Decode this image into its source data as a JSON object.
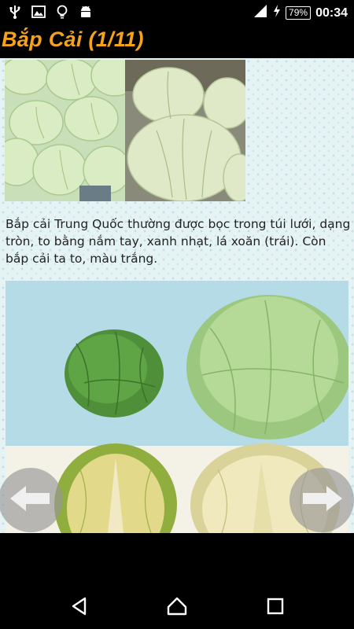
{
  "status_bar": {
    "left_icons": [
      "usb-icon",
      "image-icon",
      "lightbulb-icon",
      "android-icon"
    ],
    "battery_percent": "79%",
    "time": "00:34"
  },
  "page": {
    "title": "Bắp Cải (1/11)"
  },
  "content": {
    "caption": "Bắp cải Trung Quốc thường được bọc trong túi lưới, dạng tròn, to bằng nắm tay, xanh nhạt, lá xoăn (trái). Còn bắp cải ta to, màu trắng.",
    "colors": {
      "title": "#f7a21b",
      "background": "#e6f3f5"
    }
  },
  "navigation": {
    "prev_icon": "arrow-left-icon",
    "next_icon": "arrow-right-icon"
  },
  "system_nav": {
    "icons": [
      "back-icon",
      "home-icon",
      "recents-icon"
    ]
  }
}
